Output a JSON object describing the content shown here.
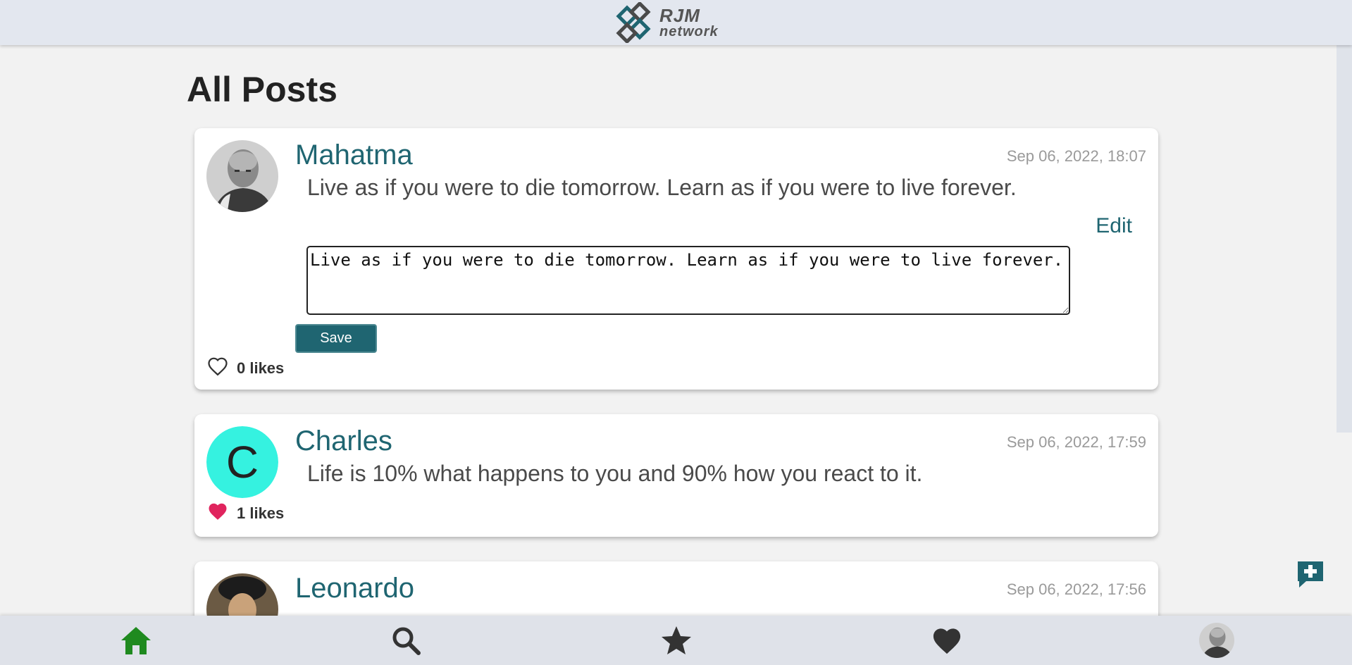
{
  "header": {
    "logo_line1": "RJM",
    "logo_line2": "network"
  },
  "page": {
    "title": "All Posts"
  },
  "posts": [
    {
      "author": "Mahatma",
      "timestamp": "Sep 06, 2022, 18:07",
      "content": "Live as if you were to die tomorrow. Learn as if you were to live forever.",
      "edit_label": "Edit",
      "edit_value": "Live as if you were to die tomorrow. Learn as if you were to live forever.",
      "save_label": "Save",
      "likes": "0 likes",
      "liked": false
    },
    {
      "author": "Charles",
      "avatar_letter": "C",
      "timestamp": "Sep 06, 2022, 17:59",
      "content": "Life is 10% what happens to you and 90% how you react to it.",
      "likes": "1 likes",
      "liked": true
    },
    {
      "author": "Leonardo",
      "timestamp": "Sep 06, 2022, 17:56"
    }
  ],
  "nav": {
    "items": [
      "home-icon",
      "search-icon",
      "star-icon",
      "heart-icon",
      "profile-avatar"
    ],
    "active": "home-icon"
  },
  "colors": {
    "accent": "#1f6571",
    "nav_active": "#1f8a1f",
    "like": "#e0245e",
    "avatar_letter_bg": "#35f2e0"
  }
}
